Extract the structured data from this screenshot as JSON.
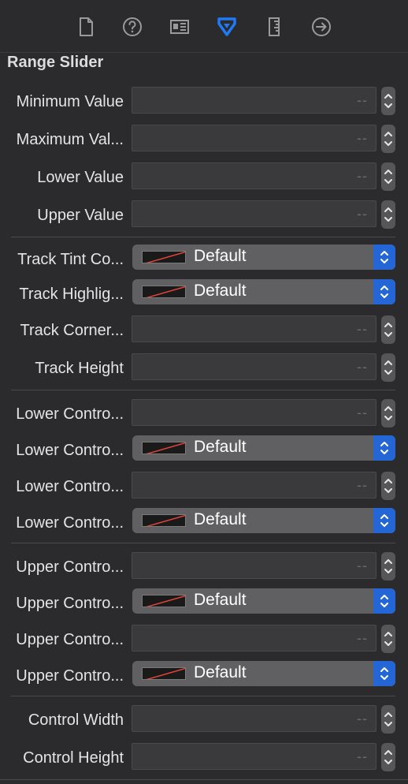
{
  "toolbar": {
    "tabs": [
      {
        "name": "file-inspector-icon"
      },
      {
        "name": "quick-help-icon"
      },
      {
        "name": "identity-inspector-icon"
      },
      {
        "name": "attributes-inspector-icon",
        "selected": true
      },
      {
        "name": "size-inspector-icon"
      },
      {
        "name": "connections-inspector-icon"
      }
    ],
    "accent": "#1f7bf4"
  },
  "section": {
    "title": "Range Slider"
  },
  "placeholder": "--",
  "popup_value": "Default",
  "rows": {
    "minimum_value": {
      "label": "Minimum Value"
    },
    "maximum_value": {
      "label": "Maximum Val..."
    },
    "lower_value": {
      "label": "Lower Value"
    },
    "upper_value": {
      "label": "Upper Value"
    },
    "track_tint": {
      "label": "Track Tint Co..."
    },
    "track_highlight": {
      "label": "Track Highlig..."
    },
    "track_corner": {
      "label": "Track Corner..."
    },
    "track_height": {
      "label": "Track Height"
    },
    "lower_control_1": {
      "label": "Lower Contro..."
    },
    "lower_control_2": {
      "label": "Lower Contro..."
    },
    "lower_control_3": {
      "label": "Lower Contro..."
    },
    "lower_control_4": {
      "label": "Lower Contro..."
    },
    "upper_control_1": {
      "label": "Upper Contro..."
    },
    "upper_control_2": {
      "label": "Upper Contro..."
    },
    "upper_control_3": {
      "label": "Upper Contro..."
    },
    "upper_control_4": {
      "label": "Upper Contro..."
    },
    "control_width": {
      "label": "Control Width"
    },
    "control_height": {
      "label": "Control Height"
    }
  }
}
